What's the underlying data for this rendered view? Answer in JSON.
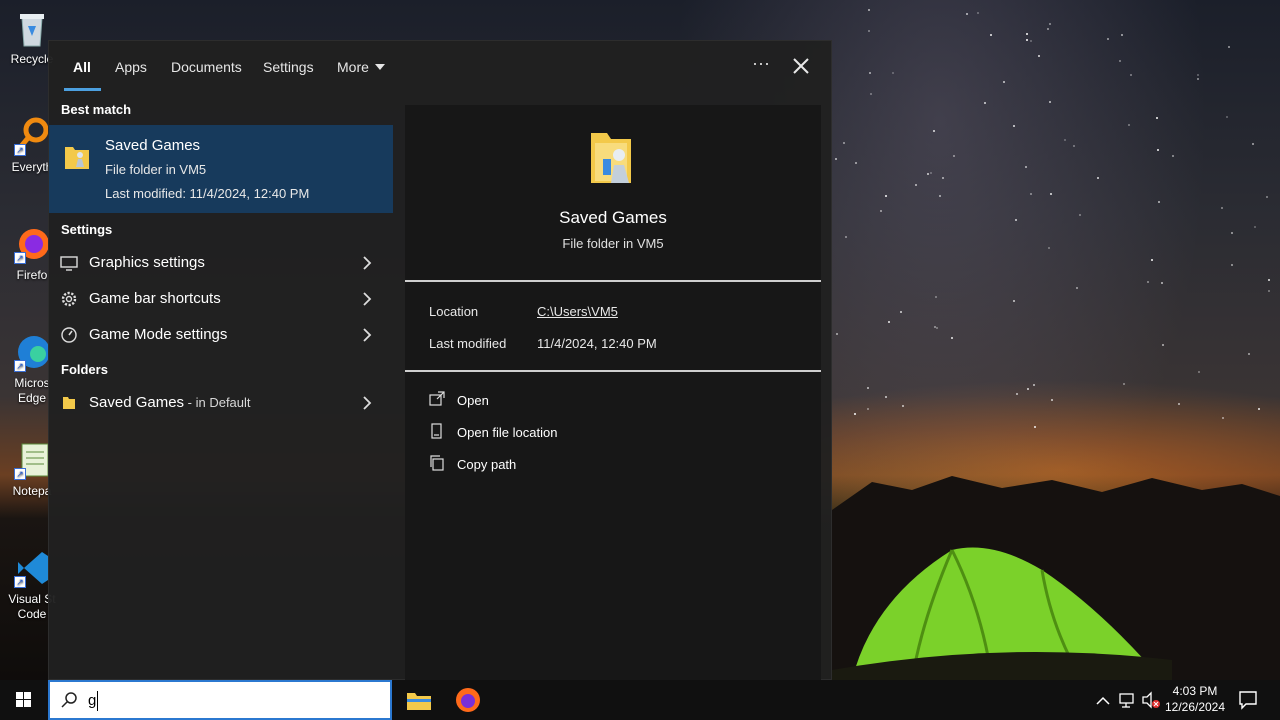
{
  "desktop": {
    "icons": [
      {
        "label": "Recycle",
        "icon": "recycle-bin-icon"
      },
      {
        "label": "Everyth",
        "icon": "everything-icon"
      },
      {
        "label": "Firefo",
        "icon": "firefox-icon"
      },
      {
        "label": "Micros Edge",
        "icon": "edge-icon"
      },
      {
        "label": "Notepa",
        "icon": "notepad-icon"
      },
      {
        "label": "Visual St Code",
        "icon": "vscode-icon"
      }
    ]
  },
  "search_panel": {
    "tabs": [
      {
        "label": "All",
        "active": true
      },
      {
        "label": "Apps"
      },
      {
        "label": "Documents"
      },
      {
        "label": "Settings"
      },
      {
        "label": "More"
      }
    ],
    "more_dots": "···",
    "sections": {
      "best_match": "Best match",
      "settings": "Settings",
      "folders": "Folders"
    },
    "best_match": {
      "title": "Saved Games",
      "type": "File folder in VM5",
      "modified": "Last modified: 11/4/2024, 12:40 PM"
    },
    "settings_items": [
      {
        "label": "Graphics settings",
        "icon": "monitor-icon"
      },
      {
        "label": "Game bar shortcuts",
        "icon": "gear-icon"
      },
      {
        "label": "Game Mode settings",
        "icon": "gauge-icon"
      }
    ],
    "folder_item": {
      "label": "Saved Games",
      "suffix": " - in Default",
      "icon": "folder-icon"
    },
    "preview": {
      "title": "Saved Games",
      "subtitle": "File folder in VM5",
      "location_label": "Location",
      "location_value": "C:\\Users\\VM5",
      "modified_label": "Last modified",
      "modified_value": "11/4/2024, 12:40 PM",
      "actions": [
        {
          "label": "Open",
          "icon": "open-icon"
        },
        {
          "label": "Open file location",
          "icon": "file-location-icon"
        },
        {
          "label": "Copy path",
          "icon": "copy-icon"
        }
      ]
    }
  },
  "taskbar": {
    "search_value": "g",
    "time": "4:03 PM",
    "date": "12/26/2024"
  },
  "colors": {
    "accent": "#4ca0e0",
    "selected_bg": "#173a5c",
    "panel_bg": "#202020",
    "preview_bg": "#171717"
  }
}
